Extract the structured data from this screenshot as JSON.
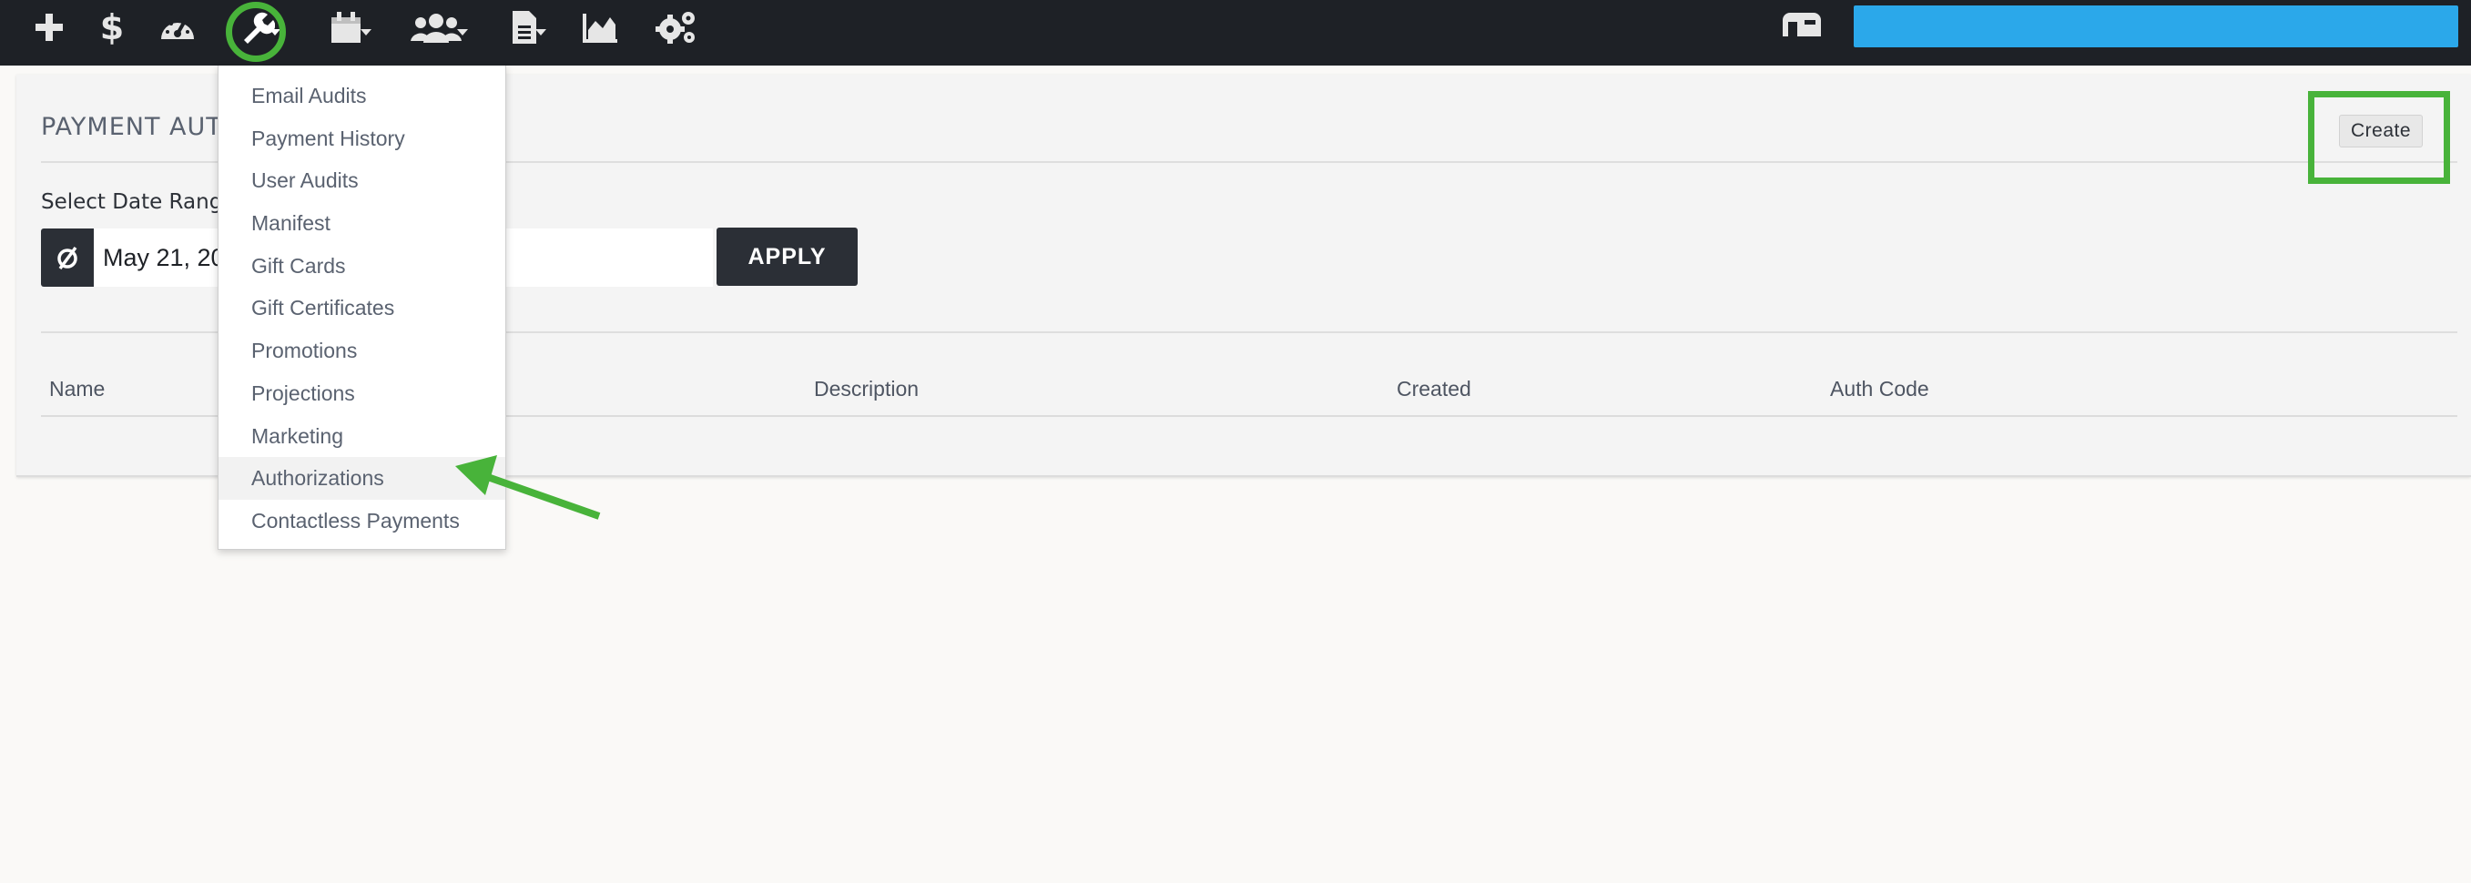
{
  "toolbar": {
    "icons": [
      "plus-icon",
      "dollar-icon",
      "dashboard-icon",
      "wrench-icon",
      "calendar-icon",
      "users-icon",
      "document-icon",
      "chart-icon",
      "gears-icon",
      "mailbox-icon"
    ]
  },
  "page": {
    "title": "PAYMENT AUT",
    "create_label": "Create",
    "date_label": "Select Date Rang",
    "date_value": "May 21, 20                              2020",
    "apply_label": "APPLY"
  },
  "table": {
    "columns": [
      "Name",
      "Description",
      "Created",
      "Auth Code"
    ]
  },
  "dropdown": {
    "items": [
      "Email Audits",
      "Payment History",
      "User Audits",
      "Manifest",
      "Gift Cards",
      "Gift Certificates",
      "Promotions",
      "Projections",
      "Marketing",
      "Authorizations",
      "Contactless Payments"
    ],
    "active_index": 9
  },
  "colors": {
    "topbar": "#1e2126",
    "accent_green": "#48b33a",
    "search_blue": "#2ba8ea",
    "dark_button": "#2b2f36"
  }
}
